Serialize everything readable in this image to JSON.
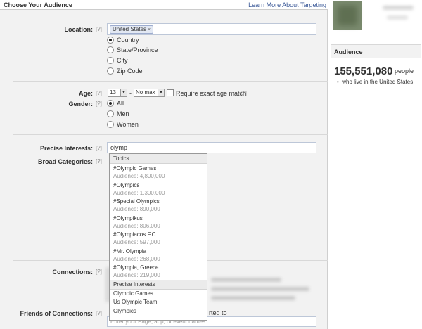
{
  "header": {
    "title": "Choose Your Audience",
    "learn_link": "Learn More About Targeting"
  },
  "help_marker": "[?]",
  "location": {
    "label": "Location:",
    "token": "United States",
    "token_remove": "×",
    "options": [
      "Country",
      "State/Province",
      "City",
      "Zip Code"
    ],
    "selected": "Country"
  },
  "age": {
    "label": "Age:",
    "min": "13",
    "dash": "-",
    "max": "No max",
    "exact_label": "Require exact age match"
  },
  "gender": {
    "label": "Gender:",
    "options": [
      "All",
      "Men",
      "Women"
    ],
    "selected": "All"
  },
  "precise_interests": {
    "label": "Precise Interests:",
    "value": "olymp"
  },
  "broad_categories": {
    "label": "Broad Categories:"
  },
  "dropdown": {
    "topics_header": "Topics",
    "topics": [
      {
        "name": "#Olympic Games",
        "audience": "Audience: 4,800,000"
      },
      {
        "name": "#Olympics",
        "audience": "Audience: 1,300,000"
      },
      {
        "name": "#Special Olympics",
        "audience": "Audience: 890,000"
      },
      {
        "name": "#Olympikus",
        "audience": "Audience: 806,000"
      },
      {
        "name": "#Olympiacos F.C.",
        "audience": "Audience: 597,000"
      },
      {
        "name": "#Mr. Olympia",
        "audience": "Audience: 268,000"
      },
      {
        "name": "#Olympia, Greece",
        "audience": "Audience: 219,000"
      }
    ],
    "interests_header": "Precise Interests",
    "interests": [
      "Olympic Games",
      "Us Olympic Team",
      "Olympics"
    ]
  },
  "connections": {
    "label": "Connections:"
  },
  "friends_of_connections": {
    "label": "Friends of Connections:",
    "partial_text": "rted to",
    "placeholder": "Enter your Page, app, or event names..."
  },
  "sidebar": {
    "audience_title": "Audience",
    "count": "155,551,080",
    "count_unit": "people",
    "bullet": "who live in the United States"
  },
  "colors": {
    "link": "#3b5998",
    "panel_bg": "#f2f2f2",
    "token_bg": "#e2e8f3"
  }
}
